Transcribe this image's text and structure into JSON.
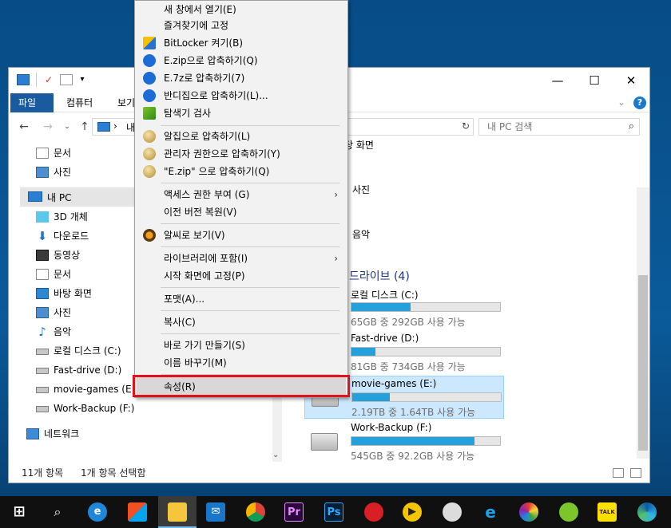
{
  "titlebar": {
    "minimize": "—",
    "maximize": "☐",
    "close": "✕"
  },
  "ribbon": {
    "file": "파일",
    "computer": "컴퓨터",
    "view": "보기",
    "help": "?"
  },
  "address": {
    "crumb": "내",
    "search_placeholder": "내 PC 검색"
  },
  "nav": {
    "items": [
      {
        "label": "문서"
      },
      {
        "label": "사진"
      },
      {
        "label": "내 PC"
      },
      {
        "label": "3D 개체"
      },
      {
        "label": "다운로드"
      },
      {
        "label": "동영상"
      },
      {
        "label": "문서"
      },
      {
        "label": "바탕 화면"
      },
      {
        "label": "사진"
      },
      {
        "label": "음악"
      },
      {
        "label": "로컬 디스크 (C:)"
      },
      {
        "label": "Fast-drive (D:)"
      },
      {
        "label": "movie-games (E:)"
      },
      {
        "label": "Work-Backup (F:)"
      },
      {
        "label": "네트워크"
      }
    ]
  },
  "content": {
    "frag_desktop": "탕 화면",
    "frag_photos": "사진",
    "frag_music": "음악",
    "drives_header": "드라이브 (4)",
    "drives": [
      {
        "name": "로컬 디스크 (C:)",
        "info": "65GB 중 292GB 사용 가능",
        "used": 0.4
      },
      {
        "name": "Fast-drive (D:)",
        "info": "81GB 중 734GB 사용 가능",
        "used": 0.16
      },
      {
        "name": "movie-games (E:)",
        "info": "2.19TB 중 1.64TB 사용 가능",
        "used": 0.25
      },
      {
        "name": "Work-Backup (F:)",
        "info": "545GB 중 92.2GB 사용 가능",
        "used": 0.83
      }
    ]
  },
  "status": {
    "count": "11개 항목",
    "selected": "1개 항목 선택함"
  },
  "menu": {
    "items": [
      {
        "label": "새 창에서 열기(E)"
      },
      {
        "label": "즐겨찾기에 고정"
      },
      {
        "label": "BitLocker 켜기(B)"
      },
      {
        "label": "E.zip으로 압축하기(Q)"
      },
      {
        "label": "E.7z로 압축하기(7)"
      },
      {
        "label": "반디집으로 압축하기(L)..."
      },
      {
        "label": "탐색기 검사"
      },
      {
        "label": "알집으로 압축하기(L)"
      },
      {
        "label": "관리자 권한으로 압축하기(Y)"
      },
      {
        "label": "\"E.zip\" 으로 압축하기(Q)"
      },
      {
        "label": "액세스 권한 부여 (G)"
      },
      {
        "label": "이전 버전 복원(V)"
      },
      {
        "label": "알씨로 보기(V)"
      },
      {
        "label": "라이브러리에 포함(I)"
      },
      {
        "label": "시작 화면에 고정(P)"
      },
      {
        "label": "포맷(A)..."
      },
      {
        "label": "복사(C)"
      },
      {
        "label": "바로 가기 만들기(S)"
      },
      {
        "label": "이름 바꾸기(M)"
      },
      {
        "label": "속성(R)"
      }
    ]
  },
  "taskbar": {
    "premiere": "Pr",
    "photoshop": "Ps",
    "talk": "TALK"
  }
}
